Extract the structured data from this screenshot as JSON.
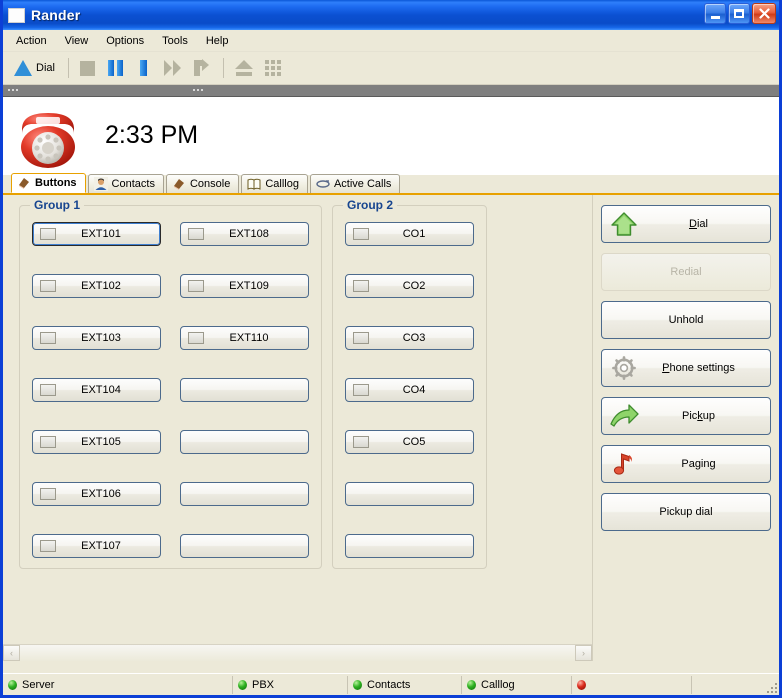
{
  "window": {
    "title": "Rander",
    "minimize_label": "Minimize",
    "maximize_label": "Maximize",
    "close_label": "Close"
  },
  "menu": {
    "items": [
      {
        "label": "Action"
      },
      {
        "label": "View"
      },
      {
        "label": "Options"
      },
      {
        "label": "Tools"
      },
      {
        "label": "Help"
      }
    ]
  },
  "toolbar": {
    "items": [
      {
        "label": "Dial",
        "icon": "dial-triangle-icon",
        "has_label": true
      },
      {
        "label": "",
        "icon": "stop-icon",
        "has_label": false
      },
      {
        "label": "",
        "icon": "pause-icon",
        "has_label": false
      },
      {
        "label": "",
        "icon": "hold-bar-icon",
        "has_label": false
      },
      {
        "label": "",
        "icon": "fast-forward-icon",
        "has_label": false
      },
      {
        "label": "",
        "icon": "redirect-arrow-icon",
        "has_label": false
      },
      {
        "label": "",
        "icon": "transfer-up-icon",
        "has_label": false
      },
      {
        "label": "",
        "icon": "keypad-grid-icon",
        "has_label": false
      }
    ]
  },
  "header": {
    "clock": "2:33 PM",
    "phone_icon": "red-rotary-phone-icon"
  },
  "tabs": [
    {
      "label": "Buttons",
      "icon": "buttons-icon",
      "active": true
    },
    {
      "label": "Contacts",
      "icon": "contacts-person-icon",
      "active": false
    },
    {
      "label": "Console",
      "icon": "console-icon",
      "active": false
    },
    {
      "label": "Calllog",
      "icon": "calllog-book-icon",
      "active": false
    },
    {
      "label": "Active Calls",
      "icon": "active-calls-icon",
      "active": false
    }
  ],
  "groups": [
    {
      "title": "Group 1",
      "columns": [
        {
          "buttons": [
            {
              "label": "EXT101",
              "has_led": true,
              "focused": true
            },
            {
              "label": "EXT102",
              "has_led": true,
              "focused": false
            },
            {
              "label": "EXT103",
              "has_led": true,
              "focused": false
            },
            {
              "label": "EXT104",
              "has_led": true,
              "focused": false
            },
            {
              "label": "EXT105",
              "has_led": true,
              "focused": false
            },
            {
              "label": "EXT106",
              "has_led": true,
              "focused": false
            },
            {
              "label": "EXT107",
              "has_led": true,
              "focused": false
            }
          ]
        },
        {
          "buttons": [
            {
              "label": "EXT108",
              "has_led": true,
              "focused": false
            },
            {
              "label": "EXT109",
              "has_led": true,
              "focused": false
            },
            {
              "label": "EXT110",
              "has_led": true,
              "focused": false
            },
            {
              "label": "",
              "has_led": false,
              "focused": false
            },
            {
              "label": "",
              "has_led": false,
              "focused": false
            },
            {
              "label": "",
              "has_led": false,
              "focused": false
            },
            {
              "label": "",
              "has_led": false,
              "focused": false
            }
          ]
        }
      ]
    },
    {
      "title": "Group 2",
      "columns": [
        {
          "buttons": [
            {
              "label": "CO1",
              "has_led": true,
              "focused": false
            },
            {
              "label": "CO2",
              "has_led": true,
              "focused": false
            },
            {
              "label": "CO3",
              "has_led": true,
              "focused": false
            },
            {
              "label": "CO4",
              "has_led": true,
              "focused": false
            },
            {
              "label": "CO5",
              "has_led": true,
              "focused": false
            },
            {
              "label": "",
              "has_led": false,
              "focused": false
            },
            {
              "label": "",
              "has_led": false,
              "focused": false
            }
          ]
        }
      ]
    }
  ],
  "actions": [
    {
      "label": "Dial",
      "accel": "D",
      "icon": "green-up-arrow-icon",
      "disabled": false
    },
    {
      "label": "Redial",
      "accel": "",
      "icon": "",
      "disabled": true
    },
    {
      "label": "Unhold",
      "accel": "",
      "icon": "",
      "disabled": false
    },
    {
      "label": "Phone settings",
      "accel": "P",
      "icon": "gear-icon",
      "disabled": false
    },
    {
      "label": "Pickup",
      "accel": "k",
      "icon": "green-curved-arrow-icon",
      "disabled": false
    },
    {
      "label": "Paging",
      "accel": "",
      "icon": "red-music-note-icon",
      "disabled": false
    },
    {
      "label": "Pickup dial",
      "accel": "",
      "icon": "",
      "disabled": false
    }
  ],
  "scrollbar": {
    "left_arrow": "‹",
    "right_arrow": "›"
  },
  "statusbar": {
    "cells": [
      {
        "label": "Server",
        "led": "green"
      },
      {
        "label": "PBX",
        "led": "green"
      },
      {
        "label": "Contacts",
        "led": "green"
      },
      {
        "label": "Calllog",
        "led": "green"
      },
      {
        "label": "",
        "led": "red"
      }
    ]
  },
  "colors": {
    "titlebar_blue": "#0a4cc8",
    "accent_tab_orange": "#e8a100",
    "group_title_blue": "#17458f",
    "background_beige": "#ece9d8",
    "led_green": "#2eb021",
    "led_red": "#d9291a"
  }
}
